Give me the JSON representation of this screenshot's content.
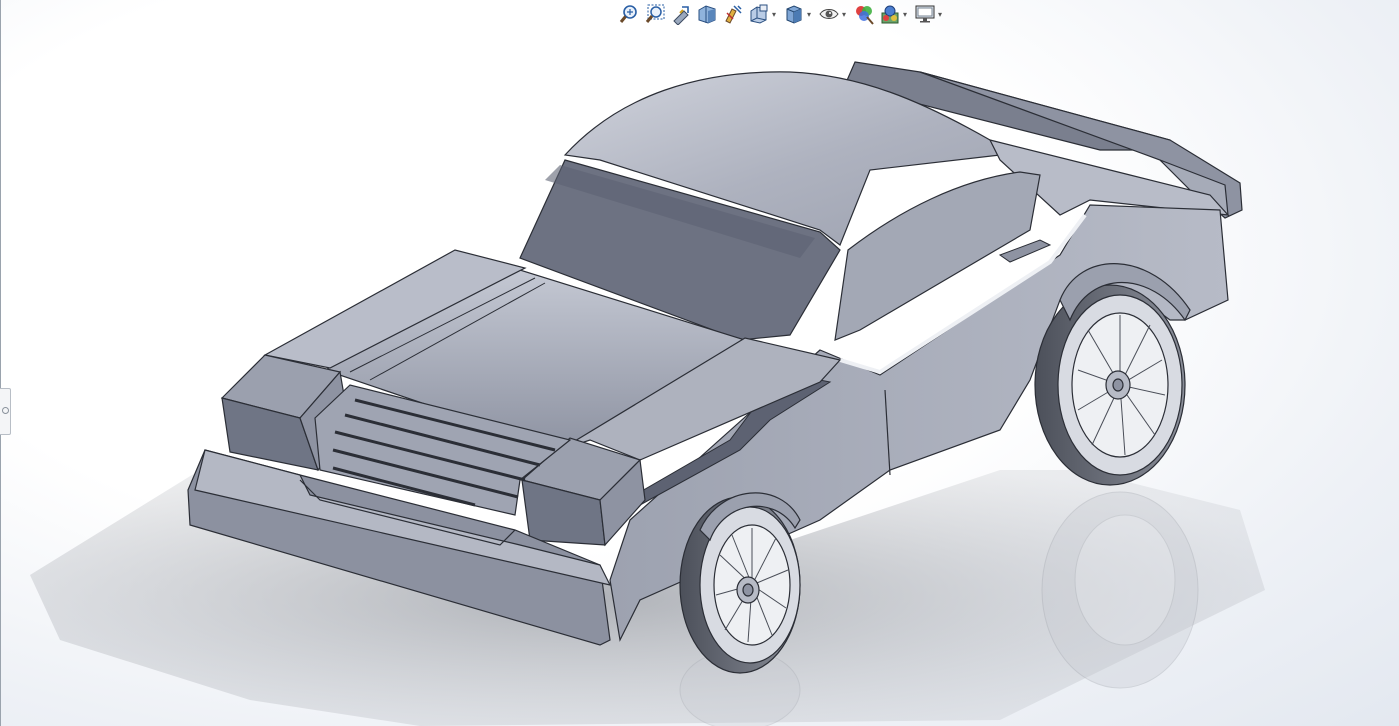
{
  "toolbar": {
    "buttons": [
      {
        "icon": "zoom-to-fit-icon",
        "dropdown": false
      },
      {
        "icon": "zoom-to-area-icon",
        "dropdown": false
      },
      {
        "icon": "previous-view-icon",
        "dropdown": false
      },
      {
        "icon": "section-view-icon",
        "dropdown": false
      },
      {
        "icon": "dynamic-annotation-views-icon",
        "dropdown": false
      },
      {
        "icon": "view-orientation-icon",
        "dropdown": true
      },
      {
        "icon": "display-style-icon",
        "dropdown": true
      },
      {
        "icon": "hide-show-items-icon",
        "dropdown": true
      },
      {
        "icon": "edit-appearance-icon",
        "dropdown": false
      },
      {
        "icon": "apply-scene-icon",
        "dropdown": true
      },
      {
        "icon": "view-settings-icon",
        "dropdown": true
      }
    ],
    "dropdown_glyph": "▾"
  },
  "colors": {
    "body": "#a9aebd",
    "body_dark": "#6f7585",
    "outline": "#2b2e36",
    "shadow": "#8f939b"
  }
}
